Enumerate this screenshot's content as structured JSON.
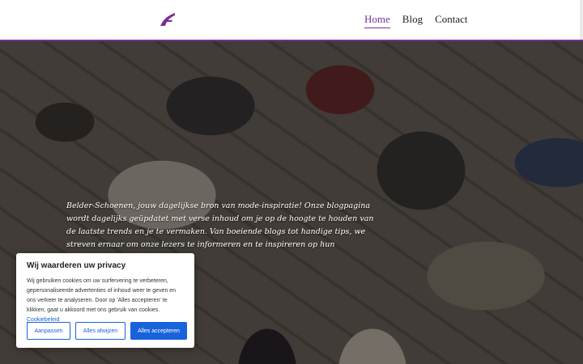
{
  "header": {
    "nav": {
      "home": "Home",
      "blog": "Blog",
      "contact": "Contact"
    },
    "accent_color": "#7a2d9c",
    "logo_icon": "shoe-stripe-logo"
  },
  "hero": {
    "text": "Belder-Schoenen, jouw dagelijkse bron van mode-inspiratie! Onze blogpagina wordt dagelijks geüpdatet met verse inhoud om je op de hoogte te houden van de laatste trends en je te vermaken. Van boeiende blogs tot handige tips, we streven ernaar om onze lezers te informeren en te inspireren op hun modeavontuur."
  },
  "cookie": {
    "title": "Wij waarderen uw privacy",
    "body": "Wij gebruiken cookies om uw surfervering te verbeteren, gepersonaliseerde advertenties of inhoud weer te geven en ons verkeer te analyseren. Door op 'Alles accepteren' te klikken, gaat u akkoord met ons gebruik van cookies.",
    "policy_link": "Cookiebeleid",
    "btn_customize": "Aanpassen",
    "btn_reject": "Alles afwijzen",
    "btn_accept": "Alles accepteren",
    "button_color": "#1863dc"
  }
}
